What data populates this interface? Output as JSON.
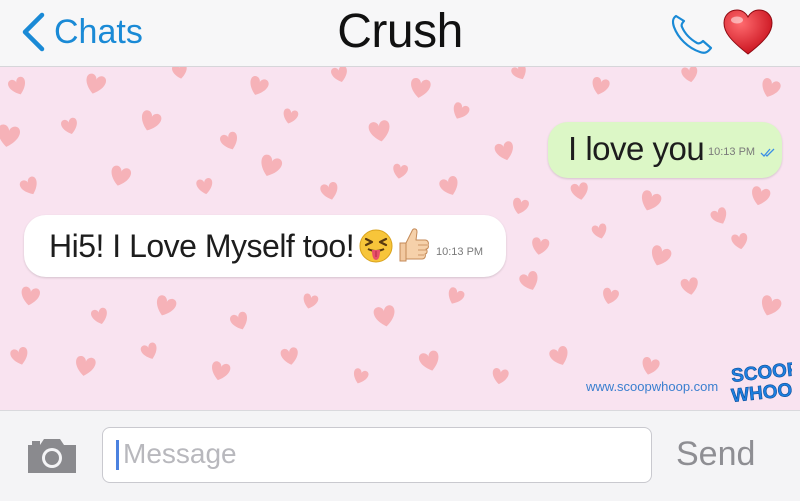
{
  "header": {
    "back_label": "Chats",
    "title": "Crush",
    "icons": [
      "chevron-left-icon",
      "phone-icon",
      "heart-icon"
    ]
  },
  "messages": [
    {
      "direction": "outgoing",
      "text": "I love you",
      "time": "10:13 PM",
      "status": "read"
    },
    {
      "direction": "incoming",
      "text": "Hi5! I Love Myself too!",
      "emoji": [
        "squinting-tongue-face",
        "thumbs-up"
      ],
      "time": "10:13 PM"
    }
  ],
  "watermark": {
    "url": "www.scoopwhoop.com",
    "logo_line1": "SCOOP",
    "logo_line2": "WHOOP"
  },
  "composer": {
    "placeholder": "Message",
    "send_label": "Send"
  },
  "colors": {
    "accent": "#1a8ad6",
    "chat_background": "#f9e3f0",
    "outgoing_bubble": "#dcf7c6",
    "incoming_bubble": "#ffffff",
    "pattern_heart": "#f4a2a6",
    "heart_button": "#e0202a"
  }
}
